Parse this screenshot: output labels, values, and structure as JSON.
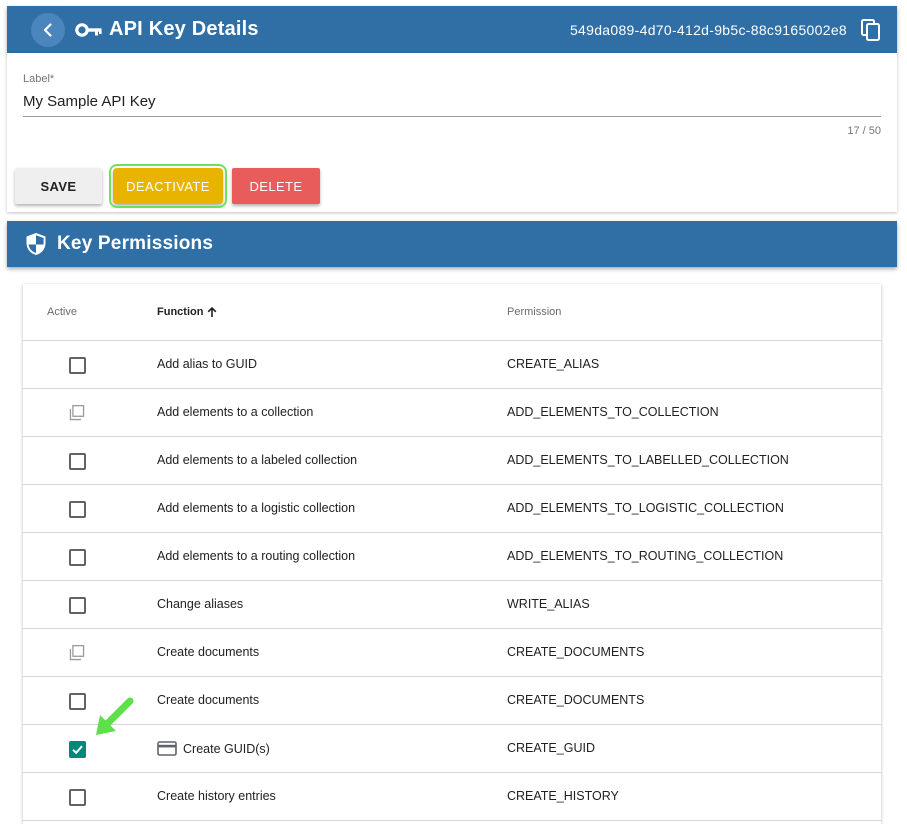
{
  "header": {
    "title": "API Key Details",
    "key_id": "549da089-4d70-412d-9b5c-88c9165002e8",
    "back_icon": "chevron-left-icon",
    "title_icon": "key-icon",
    "copy_icon": "copy-icon"
  },
  "form": {
    "label_caption": "Label*",
    "label_value": "My Sample API Key",
    "counter": "17 / 50",
    "save_label": "SAVE",
    "deactivate_label": "DEACTIVATE",
    "delete_label": "DELETE"
  },
  "permissions": {
    "title": "Key Permissions",
    "title_icon": "shield-icon",
    "columns": {
      "active": "Active",
      "function": "Function",
      "permission": "Permission"
    },
    "sort": "ascending",
    "rows": [
      {
        "function": "Add alias to GUID",
        "permission": "CREATE_ALIAS",
        "state": "unchecked",
        "icon": ""
      },
      {
        "function": "Add elements to a collection",
        "permission": "ADD_ELEMENTS_TO_COLLECTION",
        "state": "multi",
        "icon": ""
      },
      {
        "function": "Add elements to a labeled collection",
        "permission": "ADD_ELEMENTS_TO_LABELLED_COLLECTION",
        "state": "unchecked",
        "icon": ""
      },
      {
        "function": "Add elements to a logistic collection",
        "permission": "ADD_ELEMENTS_TO_LOGISTIC_COLLECTION",
        "state": "unchecked",
        "icon": ""
      },
      {
        "function": "Add elements to a routing collection",
        "permission": "ADD_ELEMENTS_TO_ROUTING_COLLECTION",
        "state": "unchecked",
        "icon": ""
      },
      {
        "function": "Change aliases",
        "permission": "WRITE_ALIAS",
        "state": "unchecked",
        "icon": ""
      },
      {
        "function": "Create documents",
        "permission": "CREATE_DOCUMENTS",
        "state": "multi",
        "icon": ""
      },
      {
        "function": "Create documents",
        "permission": "CREATE_DOCUMENTS",
        "state": "unchecked",
        "icon": ""
      },
      {
        "function": "Create GUID(s)",
        "permission": "CREATE_GUID",
        "state": "checked",
        "icon": "credit-card-icon"
      },
      {
        "function": "Create history entries",
        "permission": "CREATE_HISTORY",
        "state": "unchecked",
        "icon": ""
      }
    ]
  },
  "colors": {
    "header_bar": "#2f6fa6",
    "deactivate": "#e9b400",
    "delete": "#e85c5c",
    "checked": "#00897b",
    "highlight": "#6ee25e"
  }
}
